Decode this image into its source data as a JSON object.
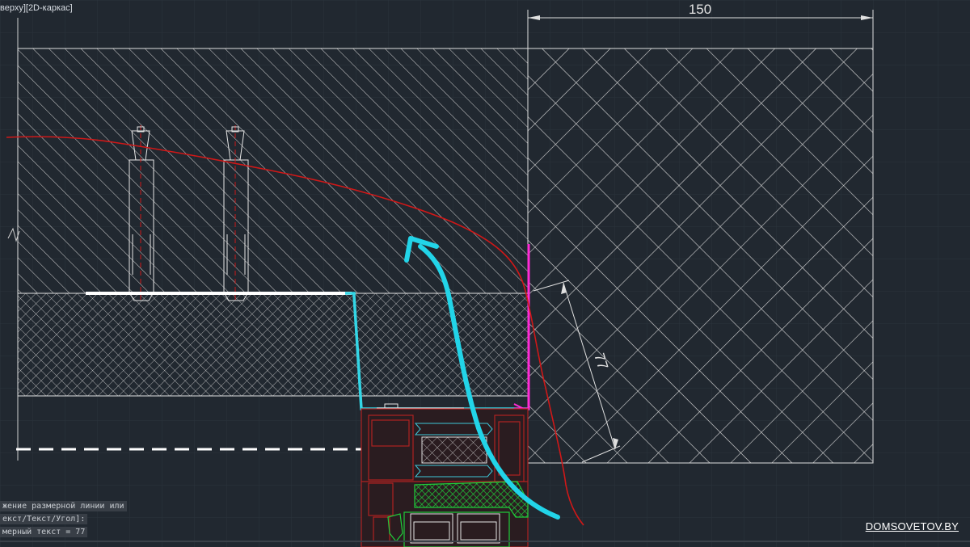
{
  "viewport": {
    "label": "верху][2D-каркас]"
  },
  "dimensions": {
    "width_label": "150",
    "diag_label": "77"
  },
  "command_line": {
    "lines": [
      "жение размерной линии или",
      "екст/Текст/Угол]:",
      "мерный текст = 77"
    ]
  },
  "watermark": {
    "text": "DOMSOVETOV.BY"
  },
  "colors": {
    "background": "#212830",
    "grid": "#2b333c",
    "cad_lines": "#e8e8e8",
    "red_line": "#d01818",
    "cyan_arrow": "#22d4e8",
    "cyan_outline": "#33d6e6",
    "magenta": "#ff2bd6",
    "profile_red": "#b02222",
    "seal_green": "#1fcc3a"
  }
}
